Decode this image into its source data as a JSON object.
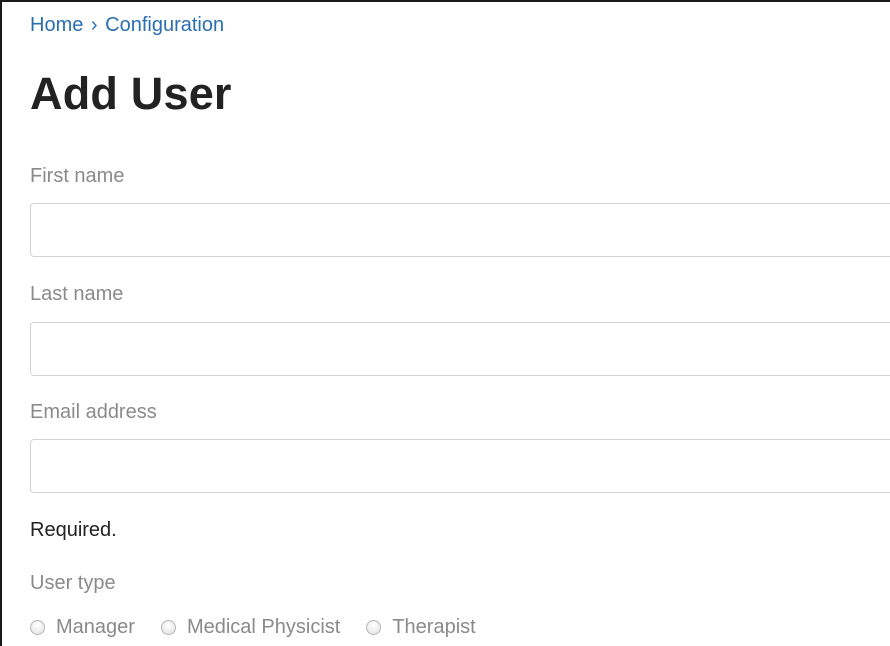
{
  "breadcrumb": {
    "items": [
      "Home",
      "Configuration"
    ],
    "separator": "›"
  },
  "page": {
    "title": "Add User"
  },
  "form": {
    "first_name": {
      "label": "First name",
      "value": "",
      "placeholder": ""
    },
    "last_name": {
      "label": "Last name",
      "value": "",
      "placeholder": ""
    },
    "email": {
      "label": "Email address",
      "value": "",
      "placeholder": ""
    },
    "required_note": "Required.",
    "user_type": {
      "label": "User type",
      "options": [
        "Manager",
        "Medical Physicist",
        "Therapist"
      ],
      "selected": null
    }
  },
  "colors": {
    "link": "#2a6fb0",
    "title": "#222222",
    "label": "#8a8a8a",
    "input_border": "#d3d3d3"
  }
}
